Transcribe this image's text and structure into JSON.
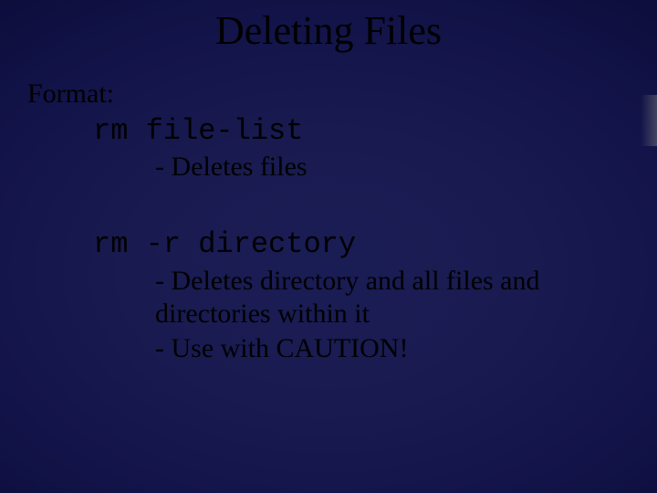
{
  "title": "Deleting Files",
  "format_label": "Format:",
  "cmd1": "rm file-list",
  "cmd1_desc1": "- Deletes files",
  "cmd2": "rm -r directory",
  "cmd2_desc1": "- Deletes directory and all files and directories within it",
  "cmd2_desc2": "- Use with CAUTION!"
}
